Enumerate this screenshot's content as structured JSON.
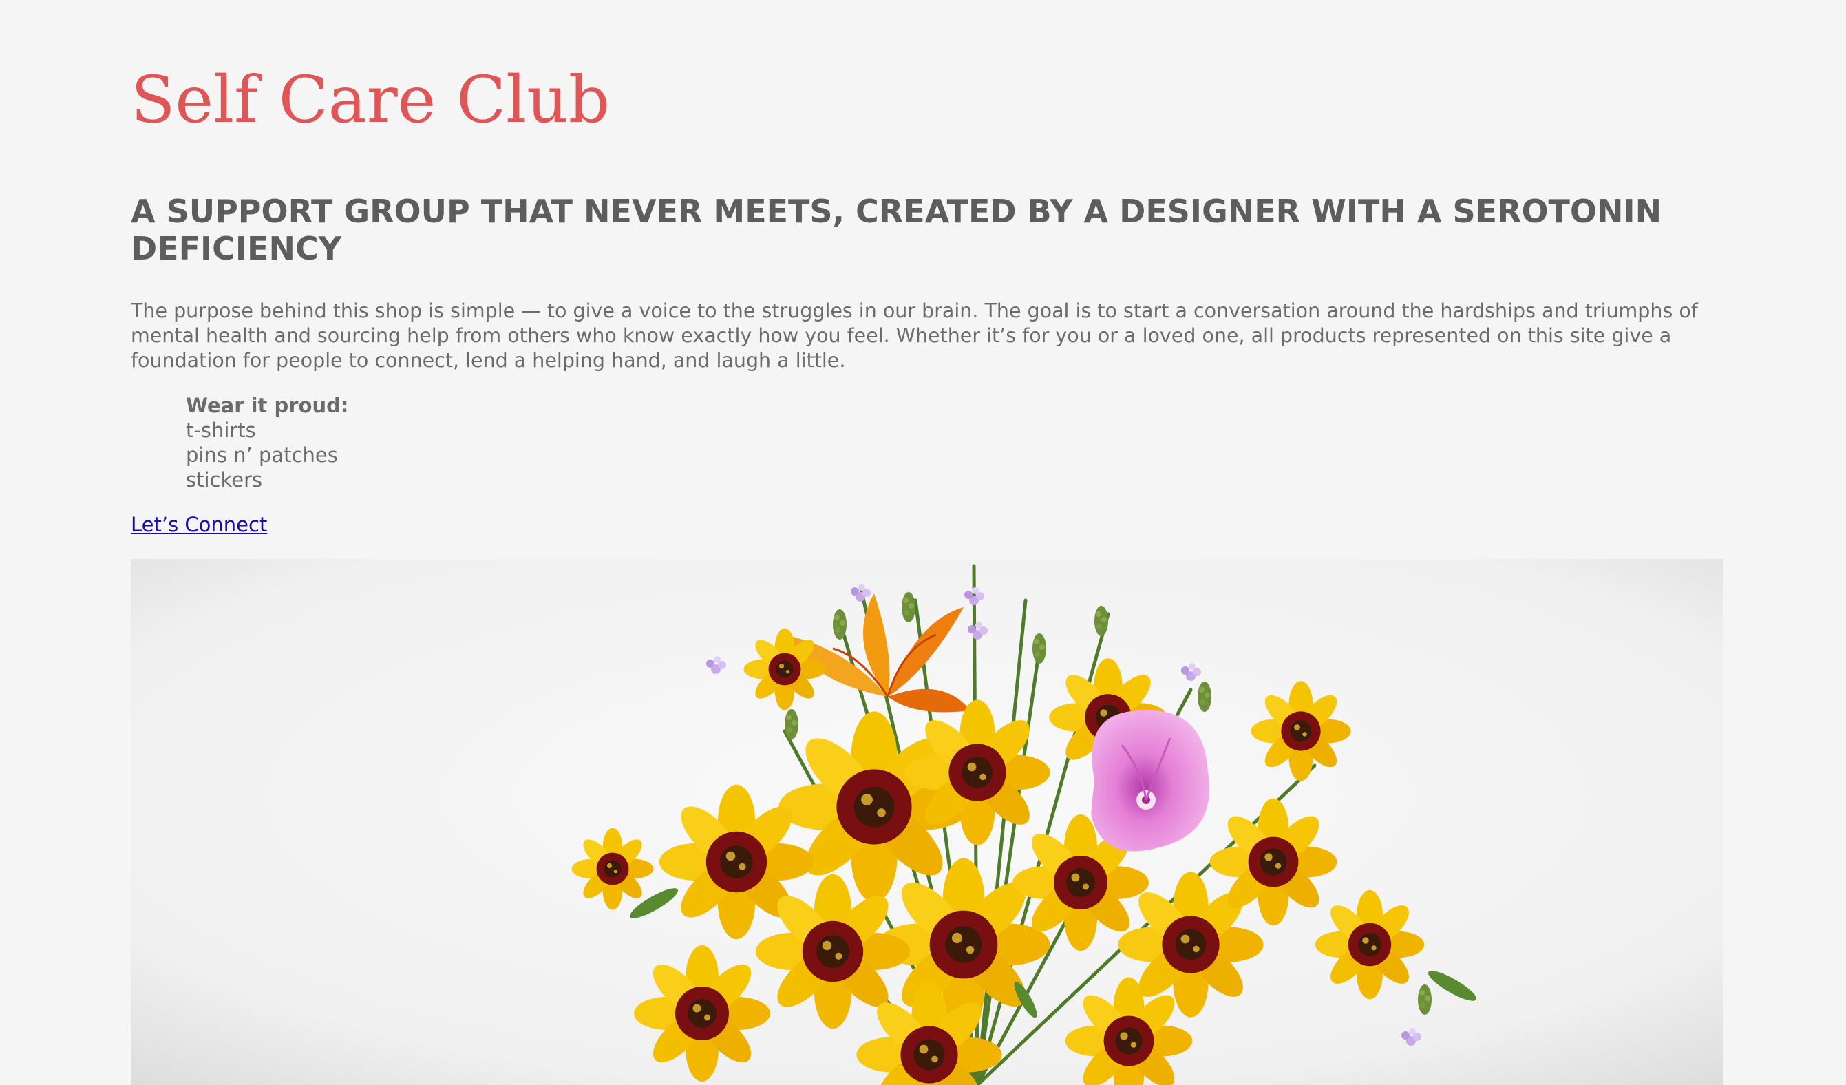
{
  "site": {
    "title": "Self Care Club",
    "tagline": "A SUPPORT GROUP THAT NEVER MEETS, CREATED BY A DESIGNER WITH A SEROTONIN DEFICIENCY",
    "intro": "The purpose behind this shop is simple — to give a voice to the struggles in our brain. The goal is to start a conversation around the hardships and triumphs of mental health and sourcing help from others who know exactly how you feel. Whether it’s for you or a loved one, all products represented on this site give a foundation for people to connect, lend a helping hand, and laugh a little."
  },
  "shop_list": {
    "heading": "Wear it proud:",
    "items": [
      "t-shirts",
      "pins n’ patches",
      "stickers"
    ]
  },
  "connect": {
    "label": "Let’s Connect"
  },
  "hero_image": {
    "icon": "flower-bouquet-photo",
    "colors": {
      "petal_yellow": "#f5c400",
      "petal_orange": "#f29a10",
      "center_maroon": "#6b0d10",
      "pink": "#e68ad6",
      "stem_green": "#4f7a2a",
      "lavender": "#c8a6e6"
    }
  },
  "colors": {
    "background": "#f5f5f5",
    "title": "#e05555",
    "heading": "#5d5d5d",
    "body_text": "#6b6b6b",
    "link": "#1a0dab"
  }
}
